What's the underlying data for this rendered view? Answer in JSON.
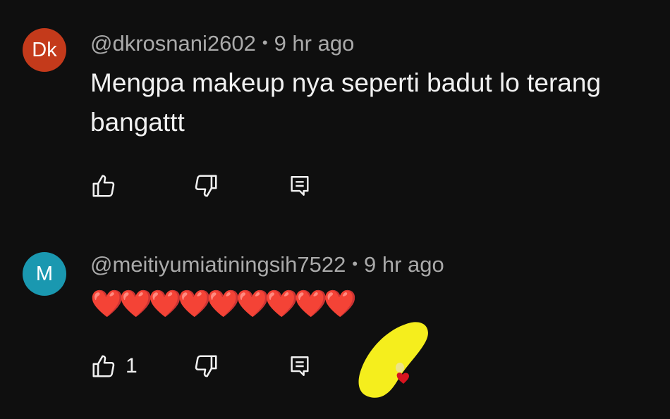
{
  "comments": [
    {
      "avatar_text": "Dk",
      "avatar_color": "#c43a1b",
      "handle": "@dkrosnani2602",
      "separator": "•",
      "time": "9 hr ago",
      "text": "Mengpa makeup nya seperti badut lo terang bangattt",
      "like_count": ""
    },
    {
      "avatar_text": "M",
      "avatar_color": "#1a98b0",
      "handle": "@meitiyumiatiningsih7522",
      "separator": "•",
      "time": "9 hr ago",
      "text": "❤️❤️❤️❤️❤️❤️❤️❤️❤️",
      "like_count": "1"
    }
  ],
  "icons": {
    "like": "thumb-up-icon",
    "dislike": "thumb-down-icon",
    "reply": "reply-icon"
  },
  "colors": {
    "background": "#0f0f0f",
    "text_primary": "#f1f1f1",
    "text_secondary": "#aaaaaa",
    "sticker_yellow": "#f5ee1d"
  }
}
